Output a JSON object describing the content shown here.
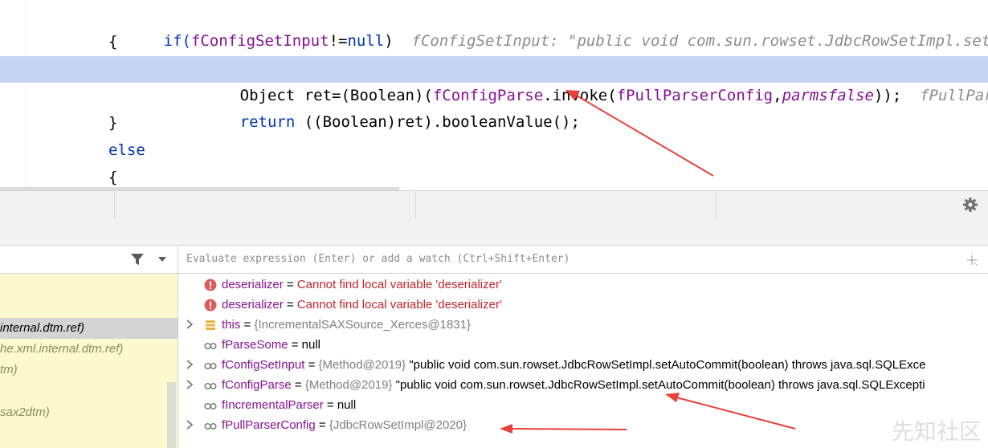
{
  "editor": {
    "lines": [
      {
        "indent": "",
        "segments": [
          {
            "t": "if(",
            "c": "kw"
          },
          {
            "t": "fConfigSetInput",
            "c": "fld"
          },
          {
            "t": "!=",
            "c": ""
          },
          {
            "t": "null",
            "c": "kw"
          },
          {
            "t": ")  ",
            "c": ""
          },
          {
            "t": "fConfigSetInput: \"public void com.sun.rowset.JdbcRowSetImpl.setA",
            "c": "inl"
          }
        ]
      },
      {
        "segments": [
          {
            "t": "{",
            "c": ""
          }
        ]
      },
      {
        "segments": [
          {
            "t": "Object ret=(Boolean)(",
            "c": ""
          },
          {
            "t": "fConfigParse",
            "c": "fld"
          },
          {
            "t": ".invoke(",
            "c": ""
          },
          {
            "t": "fPullParserConfig",
            "c": "fld"
          },
          {
            "t": ",",
            "c": ""
          },
          {
            "t": "parmsfalse",
            "c": "itf"
          },
          {
            "t": "));  ",
            "c": ""
          },
          {
            "t": "fPullPars",
            "c": "inl"
          }
        ]
      },
      {
        "segments": [
          {
            "t": "return",
            "c": "kw"
          },
          {
            "t": " ((Boolean)ret).booleanValue();",
            "c": ""
          }
        ]
      },
      {
        "segments": [
          {
            "t": "}",
            "c": ""
          }
        ]
      },
      {
        "segments": [
          {
            "t": "else",
            "c": "kw"
          }
        ]
      },
      {
        "segments": [
          {
            "t": "{",
            "c": ""
          }
        ]
      }
    ]
  },
  "toolbar": {
    "gear_icon": "gear-icon"
  },
  "frames": {
    "items": [
      {
        "label": ""
      },
      {
        "label": "internal.dtm.ref)"
      },
      {
        "label": "he.xml.internal.dtm.ref)"
      },
      {
        "label": "tm)"
      },
      {
        "label": ""
      },
      {
        "label": "sax2dtm)"
      }
    ]
  },
  "evaluate": {
    "placeholder": "Evaluate expression (Enter) or add a watch (Ctrl+Shift+Enter)"
  },
  "variables": [
    {
      "icon": "error-icon",
      "expand": false,
      "name": "deserializer",
      "eq": " = ",
      "ref": "",
      "value": "Cannot find local variable 'deserializer'",
      "value_style": "err"
    },
    {
      "icon": "error-icon",
      "expand": false,
      "name": "deserializer",
      "eq": " = ",
      "ref": "",
      "value": "Cannot find local variable 'deserializer'",
      "value_style": "err"
    },
    {
      "icon": "stack-icon",
      "expand": true,
      "name": "this",
      "eq": " = ",
      "ref": "{IncrementalSAXSource_Xerces@1831}",
      "value": "",
      "value_style": ""
    },
    {
      "icon": "watch-glasses-icon",
      "expand": false,
      "name": "fParseSome",
      "eq": " = ",
      "ref": "",
      "value": "null",
      "value_style": ""
    },
    {
      "icon": "watch-glasses-icon",
      "expand": true,
      "name": "fConfigSetInput",
      "eq": " = ",
      "ref": "{Method@2019} ",
      "value": "\"public void com.sun.rowset.JdbcRowSetImpl.setAutoCommit(boolean) throws java.sql.SQLExce",
      "value_style": ""
    },
    {
      "icon": "watch-glasses-icon",
      "expand": true,
      "name": "fConfigParse",
      "eq": " = ",
      "ref": "{Method@2019} ",
      "value": "\"public void com.sun.rowset.JdbcRowSetImpl.setAutoCommit(boolean) throws java.sql.SQLExcepti",
      "value_style": ""
    },
    {
      "icon": "watch-glasses-icon",
      "expand": false,
      "name": "fIncrementalParser",
      "eq": " = ",
      "ref": "",
      "value": "null",
      "value_style": ""
    },
    {
      "icon": "watch-glasses-icon",
      "expand": true,
      "name": "fPullParserConfig",
      "eq": " = ",
      "ref": "{JdbcRowSetImpl@2020}",
      "value": "",
      "value_style": ""
    }
  ],
  "watermark": "先知社区"
}
